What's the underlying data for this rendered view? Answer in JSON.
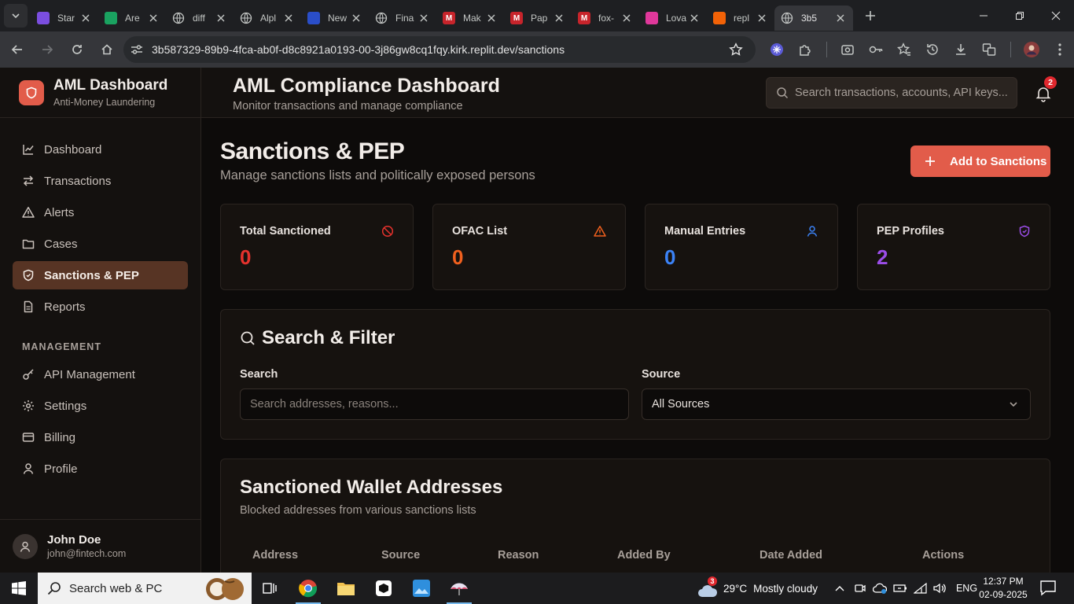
{
  "browser": {
    "tabs": [
      {
        "label": "Star",
        "fav_color": "#7b4ee0",
        "fav_text": ""
      },
      {
        "label": "Are",
        "fav_color": "#1aa260",
        "fav_text": ""
      },
      {
        "label": "diff",
        "fav_color": "",
        "fav_text": ""
      },
      {
        "label": "Alpl",
        "fav_color": "",
        "fav_text": ""
      },
      {
        "label": "New",
        "fav_color": "#2a4ec9",
        "fav_text": ""
      },
      {
        "label": "Fina",
        "fav_color": "",
        "fav_text": ""
      },
      {
        "label": "Mak",
        "fav_color": "#c7242b",
        "fav_text": "M"
      },
      {
        "label": "Pap",
        "fav_color": "#c7242b",
        "fav_text": "M"
      },
      {
        "label": "fox-",
        "fav_color": "#c7242b",
        "fav_text": "M"
      },
      {
        "label": "Lova",
        "fav_color": "#e0389b",
        "fav_text": ""
      },
      {
        "label": "repl",
        "fav_color": "#f26207",
        "fav_text": ""
      },
      {
        "label": "3b5",
        "fav_color": "",
        "fav_text": "",
        "active": true
      }
    ],
    "url": "3b587329-89b9-4fca-ab0f-d8c8921a0193-00-3j86gw8cq1fqy.kirk.replit.dev/sanctions"
  },
  "sidebar": {
    "brand_title": "AML Dashboard",
    "brand_subtitle": "Anti-Money Laundering",
    "items": [
      {
        "label": "Dashboard",
        "icon": "chart-line-icon"
      },
      {
        "label": "Transactions",
        "icon": "arrows-exchange-icon"
      },
      {
        "label": "Alerts",
        "icon": "warning-triangle-icon"
      },
      {
        "label": "Cases",
        "icon": "folder-icon"
      },
      {
        "label": "Sanctions & PEP",
        "icon": "shield-icon",
        "active": true
      },
      {
        "label": "Reports",
        "icon": "file-icon"
      }
    ],
    "section_label": "MANAGEMENT",
    "management_items": [
      {
        "label": "API Management",
        "icon": "key-icon"
      },
      {
        "label": "Settings",
        "icon": "gear-icon"
      },
      {
        "label": "Billing",
        "icon": "credit-card-icon"
      },
      {
        "label": "Profile",
        "icon": "user-icon"
      }
    ],
    "user": {
      "name": "John Doe",
      "email": "john@fintech.com"
    }
  },
  "header": {
    "title": "AML Compliance Dashboard",
    "subtitle": "Monitor transactions and manage compliance",
    "search_placeholder": "Search transactions, accounts, API keys...",
    "notification_count": "2"
  },
  "page": {
    "title": "Sanctions & PEP",
    "subtitle": "Manage sanctions lists and politically exposed persons",
    "add_button": "Add to Sanctions"
  },
  "stats": [
    {
      "label": "Total Sanctioned",
      "value": "0",
      "color": "#e5322d",
      "icon": "ban-icon"
    },
    {
      "label": "OFAC List",
      "value": "0",
      "color": "#f0601e",
      "icon": "warning-triangle-icon"
    },
    {
      "label": "Manual Entries",
      "value": "0",
      "color": "#3b82f6",
      "icon": "user-icon"
    },
    {
      "label": "PEP Profiles",
      "value": "2",
      "color": "#9b4de8",
      "icon": "shield-icon"
    }
  ],
  "filter": {
    "title": "Search & Filter",
    "search_label": "Search",
    "search_placeholder": "Search addresses, reasons...",
    "source_label": "Source",
    "source_value": "All Sources"
  },
  "table": {
    "title": "Sanctioned Wallet Addresses",
    "subtitle": "Blocked addresses from various sanctions lists",
    "columns": [
      "Address",
      "Source",
      "Reason",
      "Added By",
      "Date Added",
      "Actions"
    ]
  },
  "taskbar": {
    "search_placeholder": "Search web & PC",
    "weather_temp": "29°C",
    "weather_desc": "Mostly cloudy",
    "weather_badge": "3",
    "language": "ENG",
    "time": "12:37 PM",
    "date": "02-09-2025"
  },
  "colors": {
    "accent": "#e25c4a",
    "active_nav": "#573424"
  }
}
